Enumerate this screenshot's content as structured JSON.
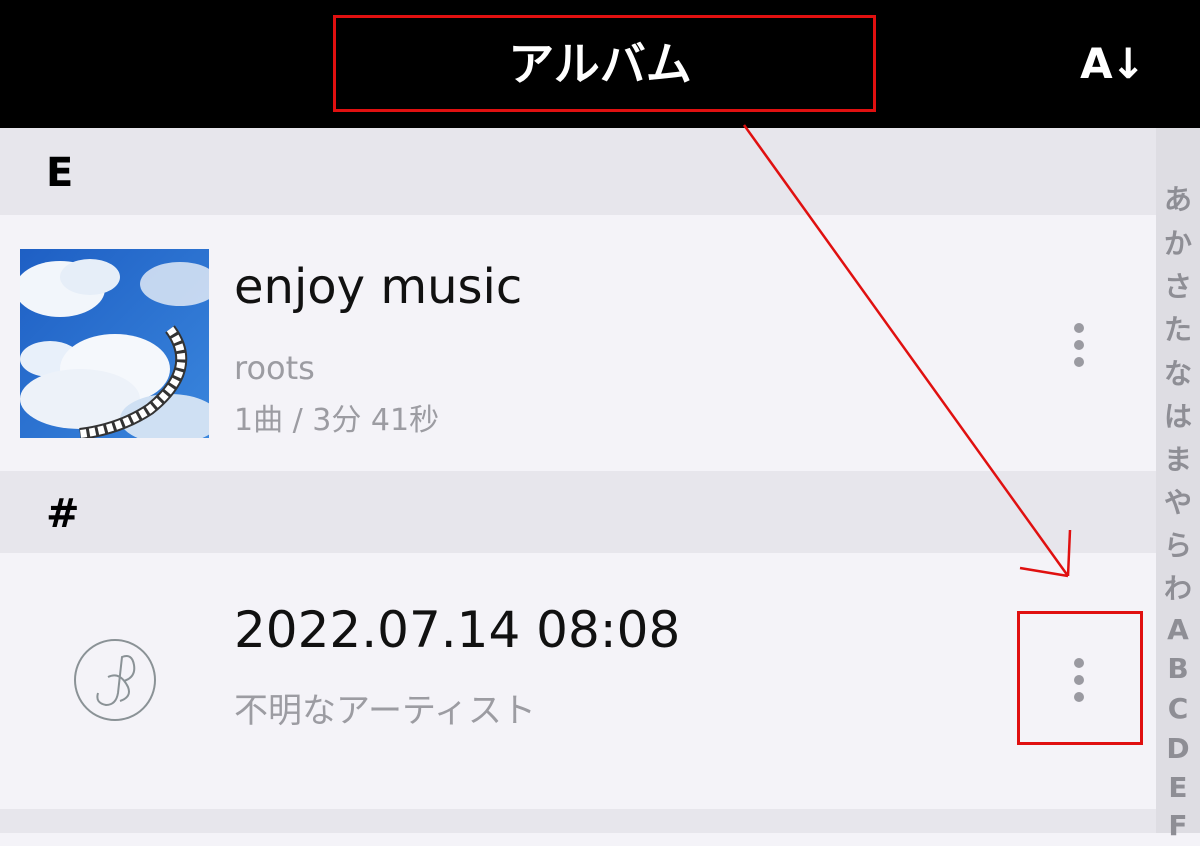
{
  "header": {
    "title": "アルバム",
    "sort_label": "A↓"
  },
  "sections": [
    {
      "letter": "E",
      "albums": [
        {
          "title": "enjoy music",
          "artist": "roots",
          "meta": "1曲 / 3分 41秒",
          "artwork": "sky-clouds-piano-artwork"
        }
      ]
    },
    {
      "letter": "#",
      "albums": [
        {
          "title": "2022.07.14 08:08",
          "artist": "不明なアーティスト",
          "artwork": "music-note-placeholder-icon"
        }
      ]
    }
  ],
  "index": [
    "あ",
    "か",
    "さ",
    "た",
    "な",
    "は",
    "ま",
    "や",
    "ら",
    "わ",
    "A",
    "B",
    "C",
    "D",
    "E",
    "F"
  ],
  "colors": {
    "header_bg": "#000000",
    "list_bg": "#f4f3f8",
    "section_bg": "#e7e6ec",
    "annotation": "#e01010"
  }
}
